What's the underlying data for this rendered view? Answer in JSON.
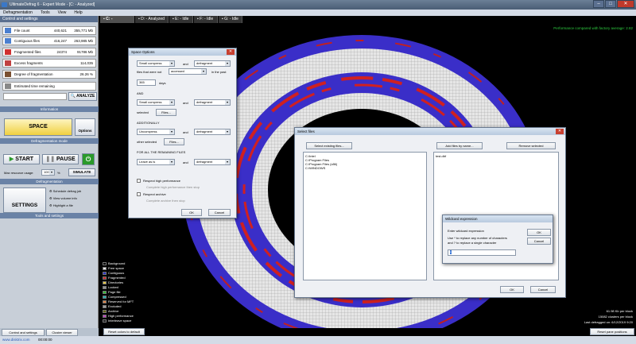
{
  "window": {
    "title": "UltimateDefrag 6 - Expert Mode - [C: - Analyzed]"
  },
  "menu": [
    "Defragmentation",
    "Tools",
    "View",
    "Help"
  ],
  "tabs": [
    {
      "label": "C: - Analyzed",
      "active": true
    },
    {
      "label": "D: - Analyzed"
    },
    {
      "label": "E: - Idle"
    },
    {
      "label": "F: - Idle"
    },
    {
      "label": "G: - Idle"
    }
  ],
  "left": {
    "header": "Control and settings",
    "stats": [
      {
        "label": "File count",
        "v1": "440,621",
        "v2": "355,771 Mb",
        "color": "#4a7fd0"
      },
      {
        "label": "Contiguous files",
        "v1": "416,247",
        "v2": "263,985 Mb",
        "color": "#4a7fd0"
      },
      {
        "label": "Fragmented files",
        "v1": "24374",
        "v2": "91786 Mb",
        "color": "#d03030"
      },
      {
        "label": "Excess fragments",
        "v1": "114,035",
        "v2": "",
        "color": "#c04040"
      },
      {
        "label": "Degree of fragmentation",
        "v1": "26.26 %",
        "v2": "",
        "color": "#7a5030"
      },
      {
        "label": "Estimated time remaining",
        "v1": "",
        "v2": "",
        "color": "#888888"
      }
    ],
    "analyze_label": "ANALYZE",
    "information_label": "Information",
    "mode_label": "SPACE",
    "options_label": "Options",
    "defrag_mode_label": "Defragmentation mode",
    "start_label": "START",
    "pause_label": "PAUSE",
    "max_resource_label": "Max resource usage:",
    "max_resource_value": "100",
    "max_resource_unit": "%",
    "simulate_label": "SIMULATE",
    "defragmentation_label": "Defragmentation",
    "settings_label": "SETTINGS",
    "links": [
      "Schedule defrag job",
      "View volume info",
      "Highlight a file"
    ],
    "tools_label": "Tools and settings"
  },
  "bottom_tabs": [
    "Control and settings",
    "Cluster viewer"
  ],
  "legend": [
    {
      "label": "Background",
      "color": "#000000"
    },
    {
      "label": "Free space",
      "color": "#e8e8e8"
    },
    {
      "label": "Contiguous",
      "color": "#2a30c8"
    },
    {
      "label": "Fragmented",
      "color": "#d02020"
    },
    {
      "label": "Directories",
      "color": "#e8c840"
    },
    {
      "label": "Locked",
      "color": "#909090"
    },
    {
      "label": "Page file",
      "color": "#30c030"
    },
    {
      "label": "Compressed",
      "color": "#20b0b0"
    },
    {
      "label": "Reserved for MFT",
      "color": "#e08040"
    },
    {
      "label": "Excluded",
      "color": "#a0a0a0"
    },
    {
      "label": "Archive",
      "color": "#606000"
    },
    {
      "label": "High performance",
      "color": "#c040c0"
    },
    {
      "label": "Interleave space",
      "color": "#202020"
    }
  ],
  "reset_colors_label": "Reset colors to default",
  "perf_text": "Performance compared with factory average: 2.82",
  "info_lines": [
    "61.98 Kb per block",
    "15082 clusters per block",
    "Last defragged on: 6/12/2019 9:20"
  ],
  "reset_pane_label": "Reset pane positions",
  "status": {
    "url": "www.disktrix.com",
    "time": "00:00:00"
  },
  "space_dialog": {
    "title": "Space Options",
    "sel1": "Small compress",
    "and1": "and",
    "sel2": "defragment",
    "files_that": "files that were not",
    "sel3": "accessed",
    "in_past": "in the past",
    "days_value": "365",
    "days": "days",
    "and_label": "AND",
    "sel4": "Small compress",
    "and2": "and",
    "sel5": "defragment",
    "selected": "selected",
    "files_btn": "Files...",
    "additionally": "ADDITIONALLY",
    "sel6": "Uncompress",
    "and3": "and",
    "sel7": "defragment",
    "other_selected": "other selected",
    "files_btn2": "Files...",
    "remaining": "FOR ALL THE REMAINING FILES",
    "sel8": "Leave as is",
    "and4": "and",
    "sel9": "defragment",
    "respect_high": "Respect high performance",
    "complete_high": "Complete high performance then stop",
    "respect_archive": "Respect archive",
    "complete_archive": "Complete archive then stop",
    "ok": "OK",
    "cancel": "Cancel"
  },
  "select_dialog": {
    "title": "Select files",
    "select_existing": "Select existing files...",
    "add_by_name": "Add files by name...",
    "remove_selected": "Remove selected",
    "left_items": [
      "C:\\Intel",
      "C:\\Program Files",
      "C:\\Program Files (x86)",
      "C:\\WINDOWS"
    ],
    "right_items": [
      "test.dbf"
    ],
    "ok": "OK",
    "cancel": "Cancel"
  },
  "wildcard_dialog": {
    "title": "Wildcard expression",
    "prompt": "Enter wildcard expression",
    "hint1": "Use * to replace any number of characters",
    "hint2": "and ? to replace a single character",
    "value": "*",
    "ok": "OK",
    "cancel": "Cancel"
  }
}
